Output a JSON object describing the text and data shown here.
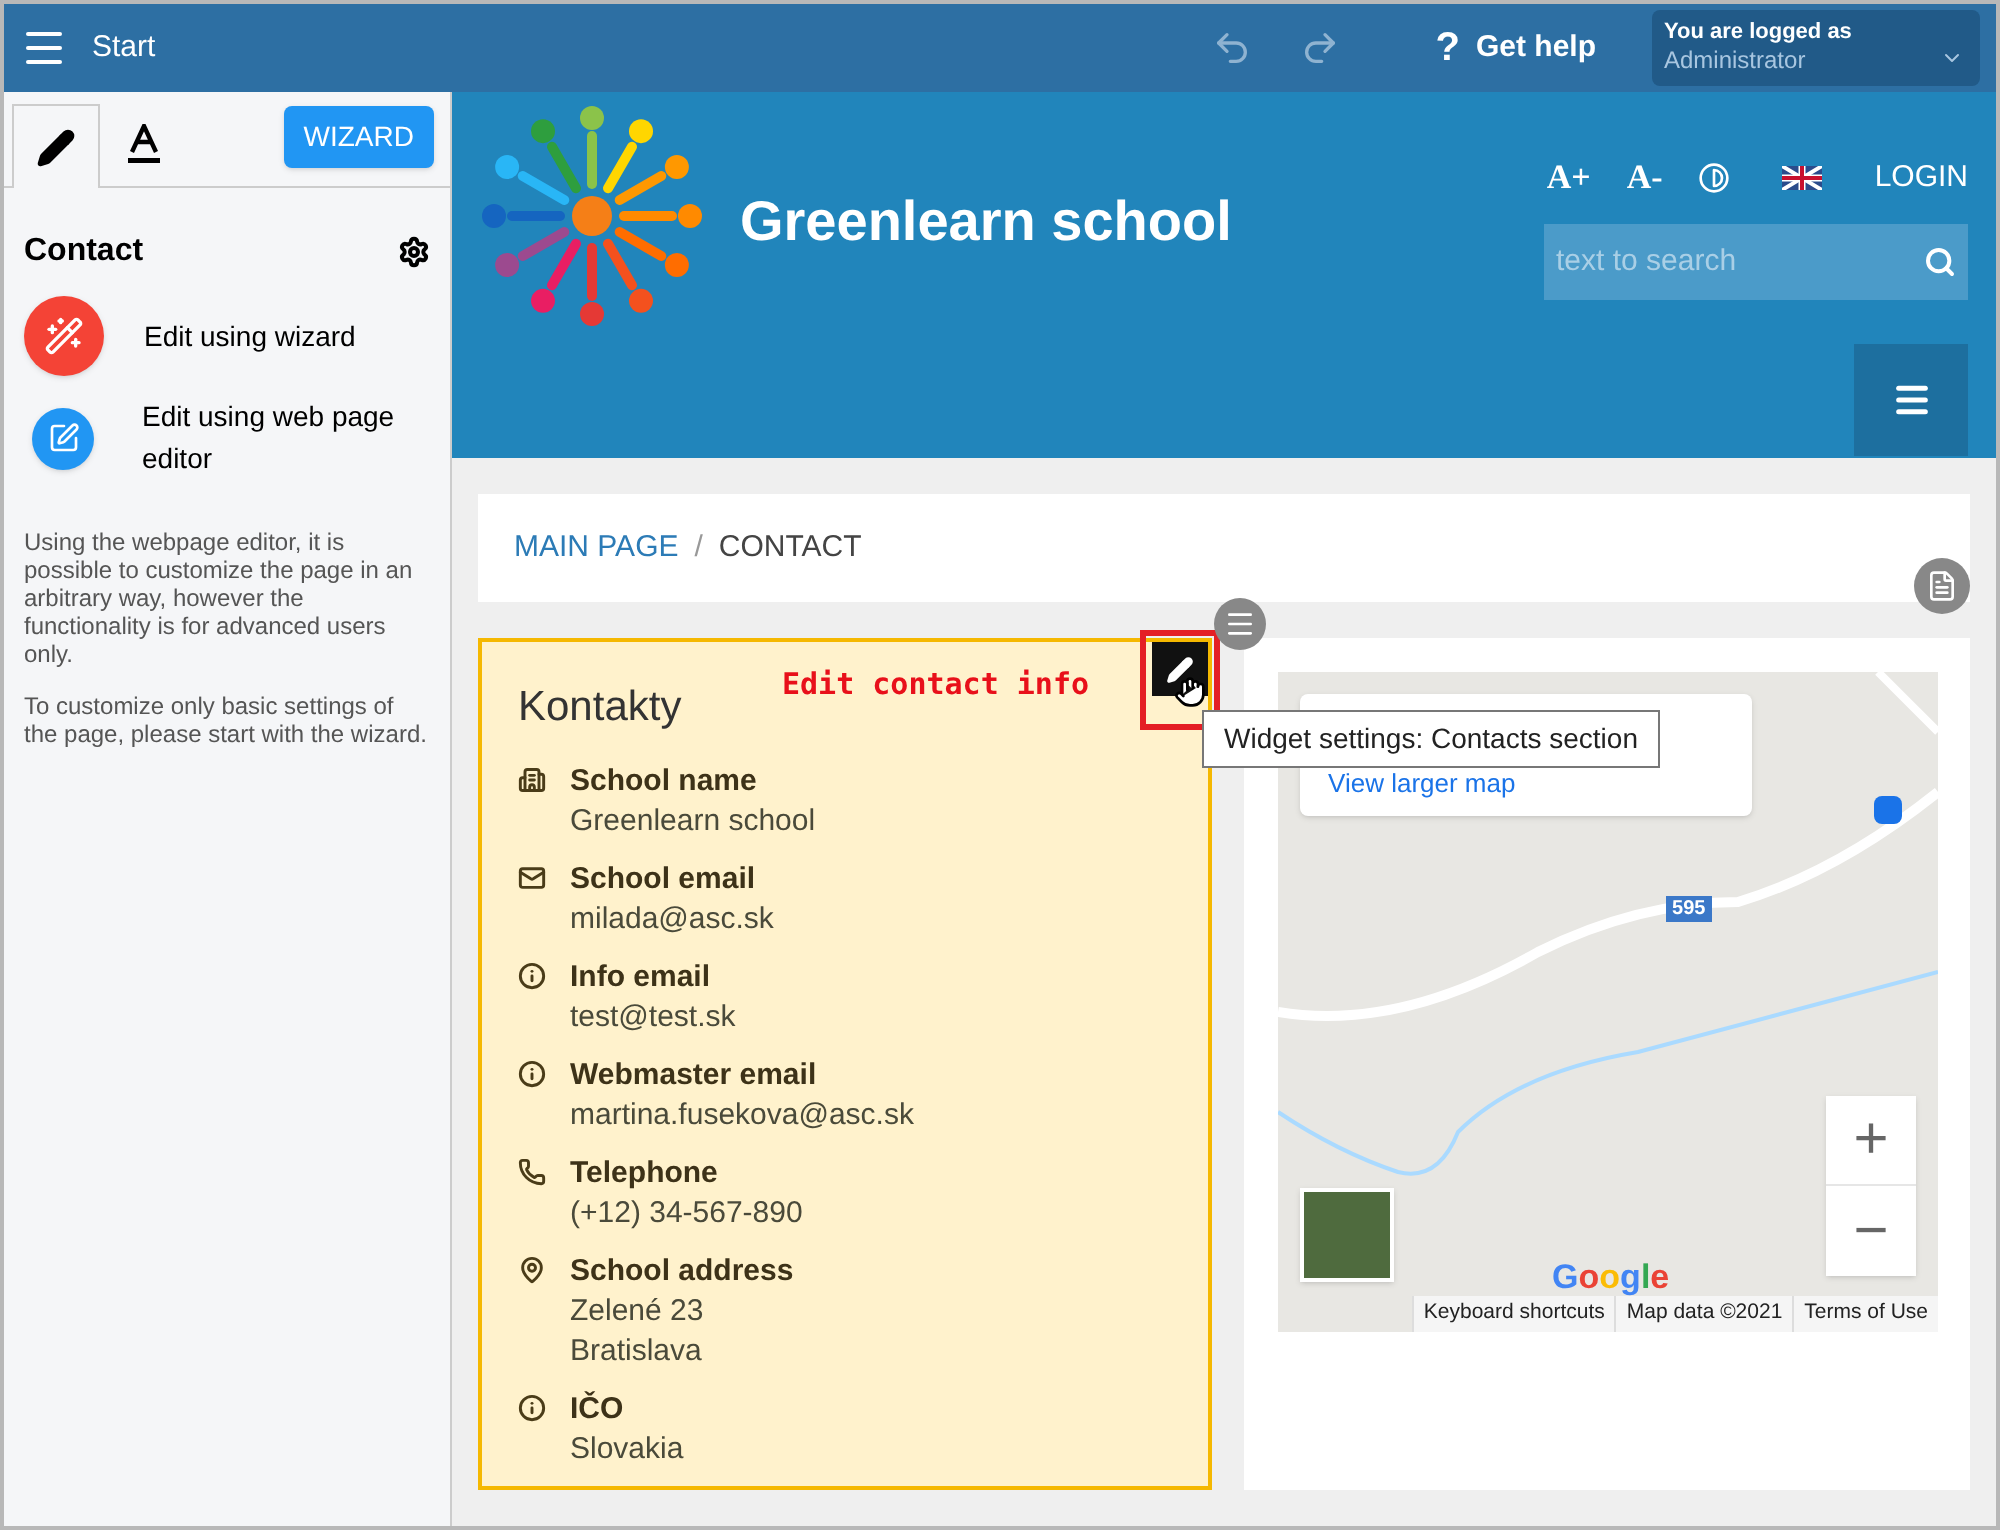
{
  "top_bar": {
    "title": "Start",
    "help_icon": "?",
    "help": "Get help",
    "user_label": "You are logged as",
    "user_name": "Administrator"
  },
  "sidebar": {
    "tabs": [
      {
        "kind": "pencil",
        "selected": true
      },
      {
        "kind": "text",
        "selected": false
      }
    ],
    "wizard_button": "WIZARD",
    "heading": "Contact",
    "actions": [
      {
        "kind": "wizard",
        "label": "Edit using wizard"
      },
      {
        "kind": "editor",
        "label": "Edit using web page editor"
      }
    ],
    "notes": [
      "Using the webpage editor, it is possible to customize the page in an arbitrary way, however the functionality is for advanced users only.",
      "To customize only basic settings of the page, please start with the wizard."
    ]
  },
  "header": {
    "school_name": "Greenlearn school",
    "font_up": "A+",
    "font_down": "A-",
    "login": "LOGIN",
    "search": {
      "placeholder": "text to search"
    }
  },
  "breadcrumb_separator": "/",
  "breadcrumb": [
    {
      "label": "MAIN PAGE",
      "selected": false
    },
    {
      "label": "CONTACT",
      "selected": true
    }
  ],
  "contacts": {
    "title": "Kontakty",
    "annotation": "Edit contact info",
    "tooltip": "Widget settings: Contacts section",
    "items": [
      {
        "kind": "building",
        "label": "School name",
        "lines": [
          "Greenlearn school"
        ]
      },
      {
        "kind": "mail",
        "label": "School email",
        "lines": [
          "milada@asc.sk"
        ]
      },
      {
        "kind": "info",
        "label": "Info email",
        "lines": [
          "test@test.sk"
        ]
      },
      {
        "kind": "info",
        "label": "Webmaster email",
        "lines": [
          "martina.fusekova@asc.sk"
        ]
      },
      {
        "kind": "phone",
        "label": "Telephone",
        "lines": [
          "(+12) 34-567-890"
        ]
      },
      {
        "kind": "pin",
        "label": "School address",
        "lines": [
          "Zelené 23",
          "Bratislava"
        ]
      },
      {
        "kind": "info",
        "label": "IČO",
        "lines": [
          "Slovakia"
        ]
      }
    ]
  },
  "map": {
    "larger_map": "View larger map",
    "road_number": "595",
    "zoom_in": "+",
    "zoom_out": "−",
    "logo": "Google",
    "footer": [
      "Keyboard shortcuts",
      "Map data ©2021",
      "Terms of Use"
    ]
  }
}
